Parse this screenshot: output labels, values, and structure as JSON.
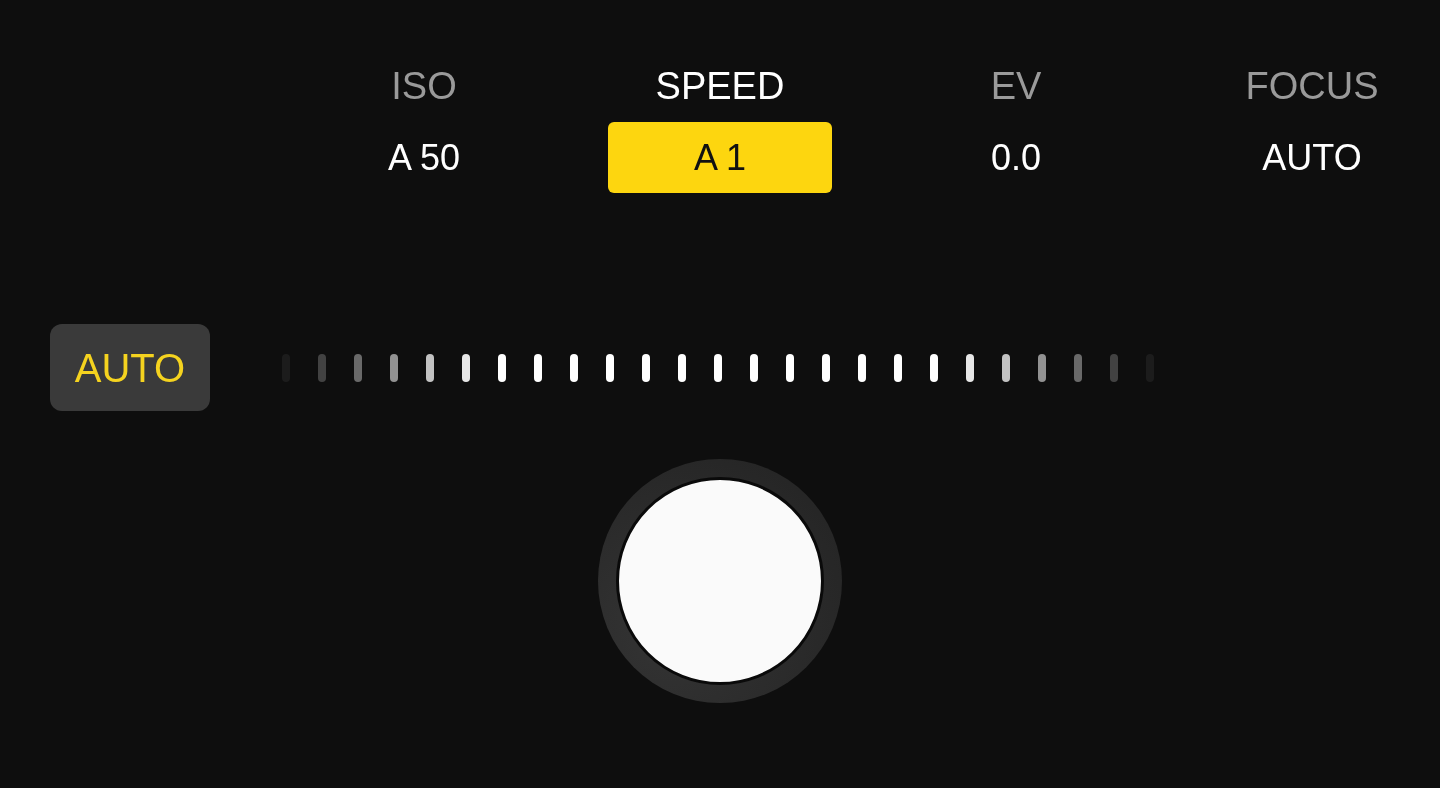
{
  "settings": [
    {
      "label": "ISO",
      "value": "A 50",
      "selected": false
    },
    {
      "label": "SPEED",
      "value": "A 1",
      "selected": true
    },
    {
      "label": "EV",
      "value": "0.0",
      "selected": false
    },
    {
      "label": "FOCUS",
      "value": "AUTO",
      "selected": false
    }
  ],
  "auto_button": {
    "label": "AUTO",
    "on": true
  }
}
